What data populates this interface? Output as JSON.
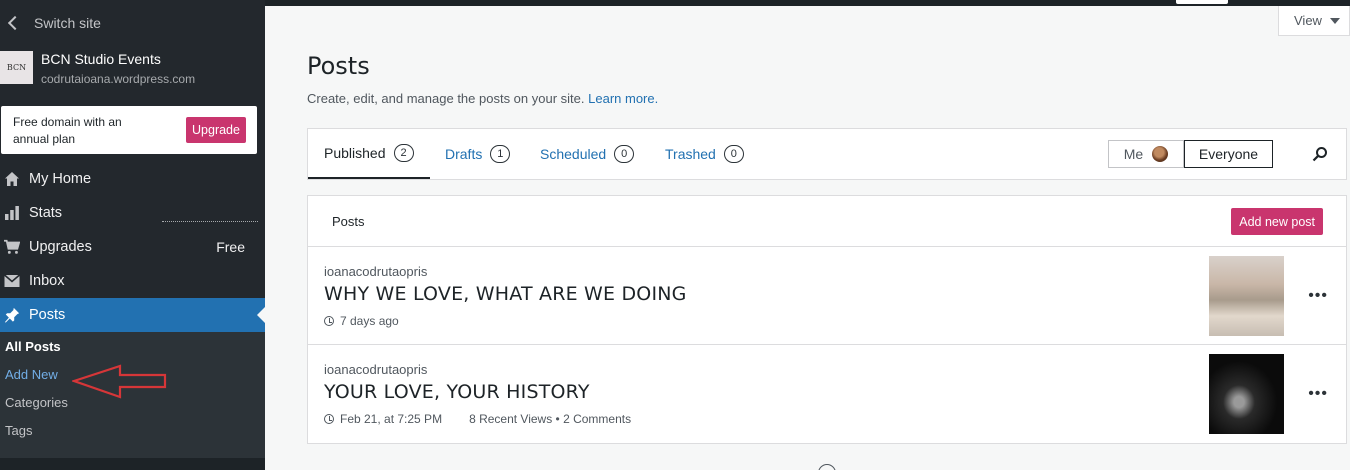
{
  "sidebar": {
    "switch_site": "Switch site",
    "site_name": "BCN Studio Events",
    "site_url": "codrutaioana.wordpress.com",
    "site_icon_text": "BCN",
    "upgrade_text": "Free domain with an annual plan",
    "upgrade_button": "Upgrade",
    "menu": [
      {
        "label": "My Home",
        "icon": "home-icon"
      },
      {
        "label": "Stats",
        "icon": "stats-icon"
      },
      {
        "label": "Upgrades",
        "icon": "cart-icon",
        "right": "Free"
      },
      {
        "label": "Inbox",
        "icon": "mail-icon"
      },
      {
        "label": "Posts",
        "icon": "pin-icon",
        "active": true
      }
    ],
    "submenu": [
      "All Posts",
      "Add New",
      "Categories",
      "Tags"
    ]
  },
  "header": {
    "view_label": "View",
    "title": "Posts",
    "subtitle": "Create, edit, and manage the posts on your site.",
    "learn_more": "Learn more."
  },
  "tabs": [
    {
      "label": "Published",
      "count": "2",
      "active": true
    },
    {
      "label": "Drafts",
      "count": "1"
    },
    {
      "label": "Scheduled",
      "count": "0"
    },
    {
      "label": "Trashed",
      "count": "0"
    }
  ],
  "author_filter": {
    "me": "Me",
    "everyone": "Everyone",
    "selected": "Everyone"
  },
  "posts": {
    "header_label": "Posts",
    "add_button": "Add new post",
    "items": [
      {
        "author": "ioanacodrutaopris",
        "title": "WHY WE LOVE, WHAT ARE WE DOING",
        "date": "7 days ago",
        "stats": ""
      },
      {
        "author": "ioanacodrutaopris",
        "title": "YOUR LOVE, YOUR HISTORY",
        "date": "Feb 21, at 7:25 PM",
        "stats": "8 Recent Views • 2 Comments"
      }
    ]
  },
  "colors": {
    "sidebar_bg": "#23282d",
    "active_blue": "#2271b1",
    "accent_pink": "#c9356e",
    "annotation_red": "#d63638"
  }
}
